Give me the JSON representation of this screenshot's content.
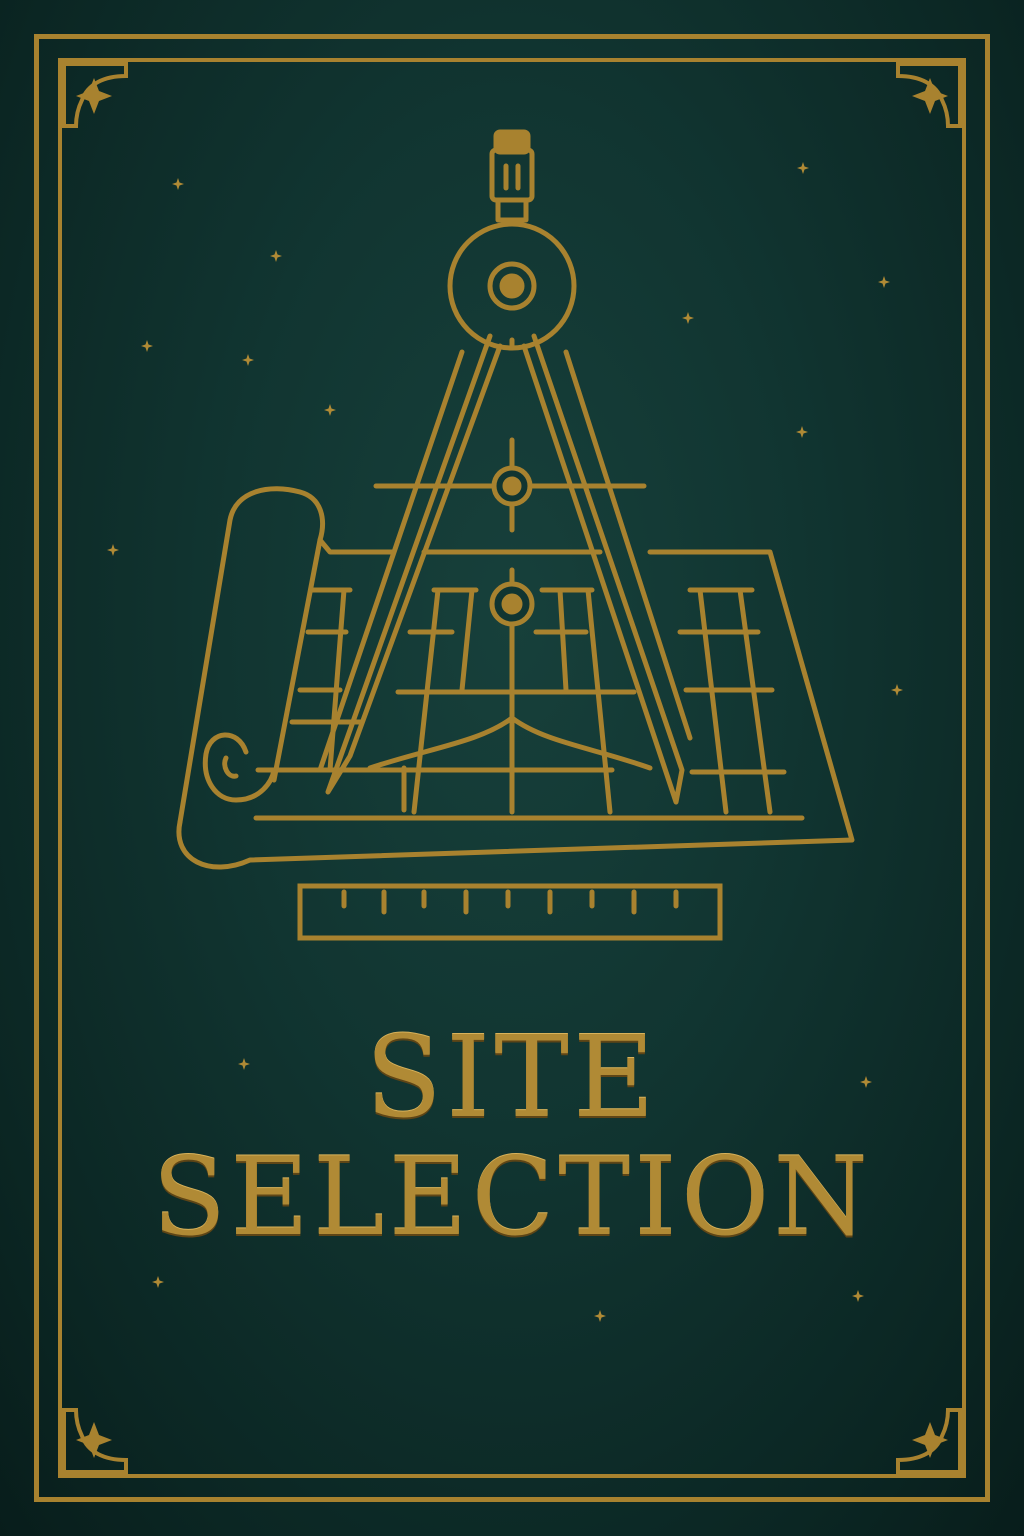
{
  "cover": {
    "title_line_1": "SITE",
    "title_line_2": "SELECTION"
  },
  "colors": {
    "background": "#113531",
    "gold": "#a8822f"
  },
  "icons": [
    "compass-icon",
    "blueprint-scroll-icon",
    "ruler-icon",
    "star-ornament-icon"
  ]
}
